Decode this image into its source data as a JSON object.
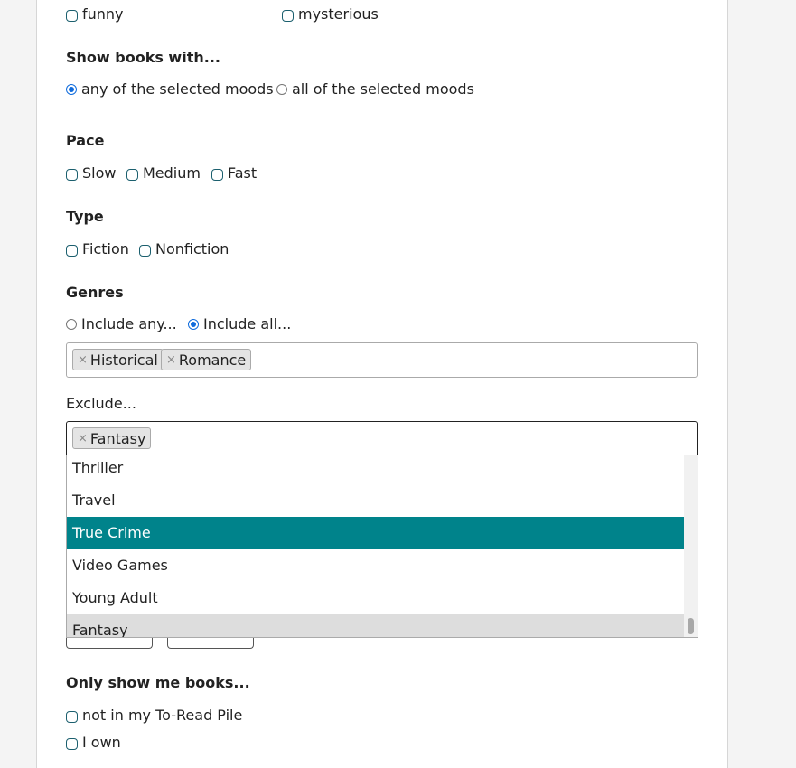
{
  "moods": {
    "options": [
      {
        "label": "funny",
        "checked": false
      },
      {
        "label": "mysterious",
        "checked": false
      }
    ]
  },
  "show_books_with": {
    "heading": "Show books with...",
    "options": [
      {
        "label": "any of the selected moods",
        "selected": true
      },
      {
        "label": "all of the selected moods",
        "selected": false
      }
    ]
  },
  "pace": {
    "heading": "Pace",
    "options": [
      {
        "label": "Slow",
        "checked": false
      },
      {
        "label": "Medium",
        "checked": false
      },
      {
        "label": "Fast",
        "checked": false
      }
    ]
  },
  "type": {
    "heading": "Type",
    "options": [
      {
        "label": "Fiction",
        "checked": false
      },
      {
        "label": "Nonfiction",
        "checked": false
      }
    ]
  },
  "genres": {
    "heading": "Genres",
    "mode_options": [
      {
        "label": "Include any...",
        "selected": false
      },
      {
        "label": "Include all...",
        "selected": true
      }
    ],
    "include_tags": [
      "Historical",
      "Romance"
    ],
    "remove_symbol": "×"
  },
  "exclude": {
    "label": "Exclude...",
    "tags": [
      "Fantasy"
    ],
    "dropdown_items": [
      {
        "label": "Thriller",
        "state": "normal"
      },
      {
        "label": "Travel",
        "state": "normal"
      },
      {
        "label": "True Crime",
        "state": "active"
      },
      {
        "label": "Video Games",
        "state": "normal"
      },
      {
        "label": "Young Adult",
        "state": "normal"
      },
      {
        "label": "Fantasy",
        "state": "selected"
      }
    ]
  },
  "only_show": {
    "heading": "Only show me books...",
    "options": [
      {
        "label": "not in my To-Read Pile",
        "checked": false
      },
      {
        "label": "I own",
        "checked": false
      }
    ]
  },
  "colors": {
    "highlight": "#00838b",
    "checkbox_border": "#1b5f6e",
    "radio_accent": "#0f6bdc"
  }
}
